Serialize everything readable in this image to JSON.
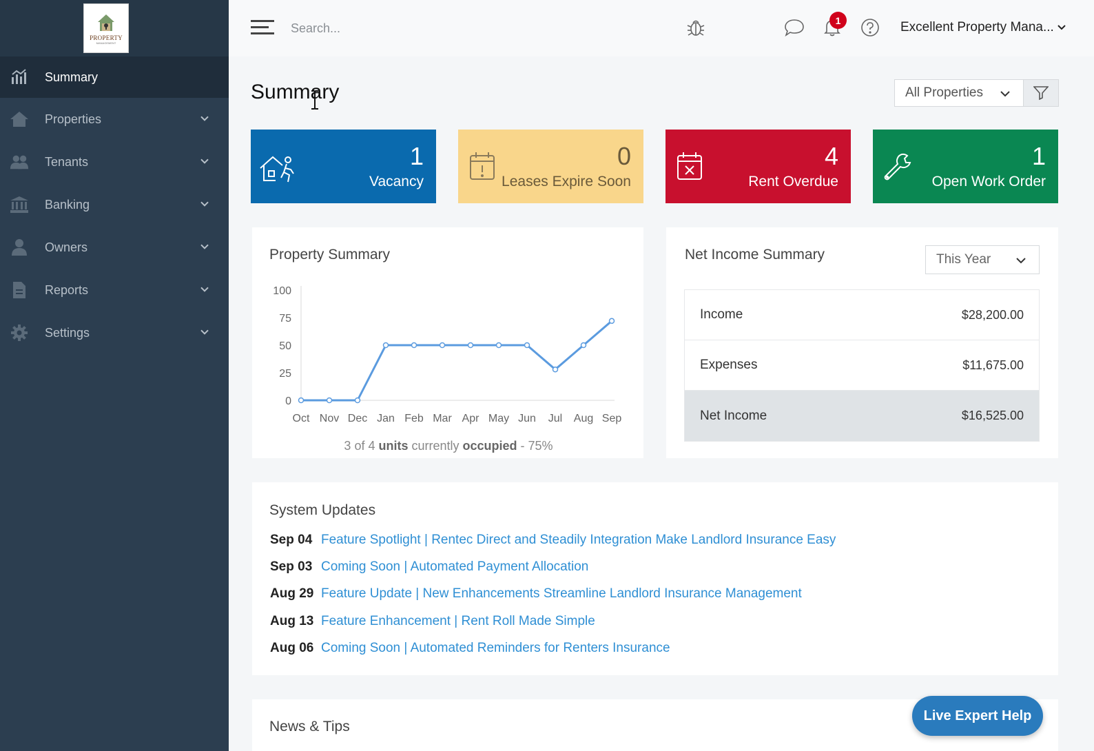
{
  "logo": {
    "text": "PROPERTY",
    "sub": "MANAGEMENT"
  },
  "sidebar": {
    "items": [
      {
        "label": "Summary",
        "icon": "bar-chart-icon",
        "active": true
      },
      {
        "label": "Properties",
        "icon": "home-icon",
        "expandable": true
      },
      {
        "label": "Tenants",
        "icon": "users-icon",
        "expandable": true
      },
      {
        "label": "Banking",
        "icon": "bank-icon",
        "expandable": true
      },
      {
        "label": "Owners",
        "icon": "user-icon",
        "expandable": true
      },
      {
        "label": "Reports",
        "icon": "document-icon",
        "expandable": true
      },
      {
        "label": "Settings",
        "icon": "gear-icon",
        "expandable": true
      }
    ]
  },
  "topbar": {
    "search_placeholder": "Search...",
    "notification_count": "1",
    "account_name": "Excellent Property Mana..."
  },
  "page": {
    "title": "Summary",
    "property_filter": "All Properties"
  },
  "stats": [
    {
      "value": "1",
      "label": "Vacancy",
      "color": "#0a6aae"
    },
    {
      "value": "0",
      "label": "Leases Expire Soon",
      "color": "#f9d68b"
    },
    {
      "value": "4",
      "label": "Rent Overdue",
      "color": "#c8102e"
    },
    {
      "value": "1",
      "label": "Open Work Order",
      "color": "#0a8752"
    }
  ],
  "property_summary": {
    "title": "Property Summary",
    "occupancy": {
      "units_occupied": "3",
      "units_total": "4",
      "percent": "75%"
    }
  },
  "chart_data": {
    "type": "line",
    "categories": [
      "Oct",
      "Nov",
      "Dec",
      "Jan",
      "Feb",
      "Mar",
      "Apr",
      "May",
      "Jun",
      "Jul",
      "Aug",
      "Sep"
    ],
    "series": [
      {
        "values": [
          0,
          0,
          0,
          50,
          50,
          50,
          50,
          50,
          50,
          28,
          50,
          72
        ]
      }
    ],
    "ylim": [
      0,
      100
    ],
    "yticks": [
      0,
      25,
      50,
      75,
      100
    ],
    "line_color": "#5b9bdf",
    "grid": false
  },
  "net_income": {
    "title": "Net Income Summary",
    "period": "This Year",
    "rows": [
      {
        "label": "Income",
        "amount": "$28,200.00"
      },
      {
        "label": "Expenses",
        "amount": "$11,675.00"
      },
      {
        "label": "Net Income",
        "amount": "$16,525.00"
      }
    ]
  },
  "system_updates": {
    "title": "System Updates",
    "items": [
      {
        "date": "Sep 04",
        "text": "Feature Spotlight | Rentec Direct and Steadily Integration Make Landlord Insurance Easy"
      },
      {
        "date": "Sep 03",
        "text": "Coming Soon | Automated Payment Allocation"
      },
      {
        "date": "Aug 29",
        "text": "Feature Update | New Enhancements Streamline Landlord Insurance Management"
      },
      {
        "date": "Aug 13",
        "text": "Feature Enhancement | Rent Roll Made Simple"
      },
      {
        "date": "Aug 06",
        "text": "Coming Soon | Automated Reminders for Renters Insurance"
      }
    ]
  },
  "news": {
    "title": "News & Tips"
  },
  "help_button": "Live Expert Help"
}
